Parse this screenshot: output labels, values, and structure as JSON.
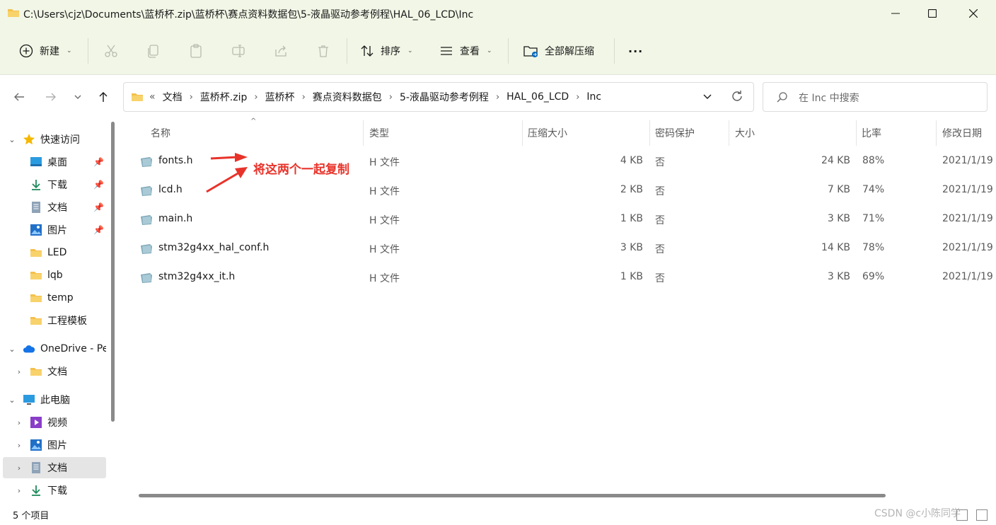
{
  "titlebar": {
    "path": "C:\\Users\\cjz\\Documents\\蓝桥杯.zip\\蓝桥杯\\赛点资料数据包\\5-液晶驱动参考例程\\HAL_06_LCD\\Inc",
    "minimize_icon": "minimize-icon",
    "maximize_icon": "maximize-icon",
    "close_icon": "close-icon"
  },
  "toolbar": {
    "new_label": "新建",
    "sort_label": "排序",
    "view_label": "查看",
    "extract_all_label": "全部解压缩",
    "more_label": "···"
  },
  "address": {
    "overflow": "«",
    "crumbs": [
      "文档",
      "蓝桥杯.zip",
      "蓝桥杯",
      "赛点资料数据包",
      "5-液晶驱动参考例程",
      "HAL_06_LCD",
      "Inc"
    ],
    "search_placeholder": "在 Inc 中搜索"
  },
  "sidebar": {
    "quick_access": "快速访问",
    "quick_items": [
      "桌面",
      "下载",
      "文档",
      "图片",
      "LED",
      "lqb",
      "temp",
      "工程模板"
    ],
    "onedrive": "OneDrive - Pe",
    "onedrive_items": [
      "文档"
    ],
    "this_pc": "此电脑",
    "pc_items": [
      "视频",
      "图片",
      "文档",
      "下载"
    ]
  },
  "columns": {
    "name": "名称",
    "type": "类型",
    "packed": "压缩大小",
    "password": "密码保护",
    "size": "大小",
    "ratio": "比率",
    "modified": "修改日期"
  },
  "files": [
    {
      "name": "fonts.h",
      "type": "H 文件",
      "packed": "4 KB",
      "password": "否",
      "size": "24 KB",
      "ratio": "88%",
      "modified": "2021/1/19"
    },
    {
      "name": "lcd.h",
      "type": "H 文件",
      "packed": "2 KB",
      "password": "否",
      "size": "7 KB",
      "ratio": "74%",
      "modified": "2021/1/19"
    },
    {
      "name": "main.h",
      "type": "H 文件",
      "packed": "1 KB",
      "password": "否",
      "size": "3 KB",
      "ratio": "71%",
      "modified": "2021/1/19"
    },
    {
      "name": "stm32g4xx_hal_conf.h",
      "type": "H 文件",
      "packed": "3 KB",
      "password": "否",
      "size": "14 KB",
      "ratio": "78%",
      "modified": "2021/1/19"
    },
    {
      "name": "stm32g4xx_it.h",
      "type": "H 文件",
      "packed": "1 KB",
      "password": "否",
      "size": "3 KB",
      "ratio": "69%",
      "modified": "2021/1/19"
    }
  ],
  "annotation": {
    "text": "将这两个一起复制",
    "color": "#e8332a"
  },
  "status": {
    "item_count": "5 个项目",
    "watermark": "CSDN @c小陈同学"
  },
  "colors": {
    "band": "#f1f6e6",
    "folder": "#f5c04a",
    "accent": "#0067c0"
  }
}
